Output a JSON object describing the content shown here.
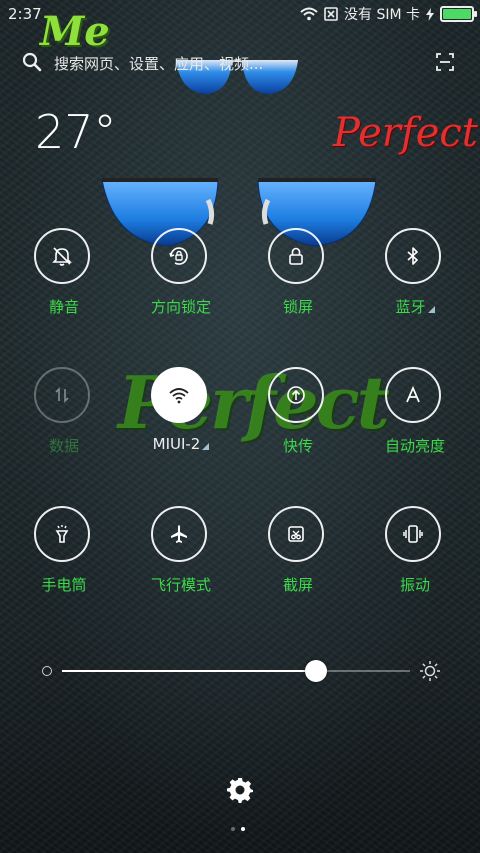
{
  "status_bar": {
    "time": "2:37",
    "carrier": "没有 SIM 卡",
    "battery_level": 1.0,
    "battery_color": "#4cd964"
  },
  "decorations": {
    "me_text": "Me",
    "perfect_red_text": "Perfect",
    "perfect_green_text": "Perfect"
  },
  "search": {
    "placeholder": "搜索网页、设置、应用、视频...",
    "icon": "search-icon",
    "scan_icon": "scan-icon"
  },
  "weather": {
    "temperature": "27°"
  },
  "tiles": [
    {
      "label": "静音",
      "icon": "bell-off-icon",
      "state": "on"
    },
    {
      "label": "方向锁定",
      "icon": "rotation-lock-icon",
      "state": "on"
    },
    {
      "label": "锁屏",
      "icon": "lock-icon",
      "state": "on"
    },
    {
      "label": "蓝牙",
      "icon": "bluetooth-icon",
      "state": "on",
      "has_submenu": true
    },
    {
      "label": "数据",
      "icon": "data-icon",
      "state": "disabled"
    },
    {
      "label": "MIUI-2",
      "icon": "wifi-icon",
      "state": "active",
      "has_submenu": true
    },
    {
      "label": "快传",
      "icon": "quick-transfer-icon",
      "state": "on"
    },
    {
      "label": "自动亮度",
      "icon": "auto-brightness-icon",
      "state": "on"
    },
    {
      "label": "手电筒",
      "icon": "flashlight-icon",
      "state": "on"
    },
    {
      "label": "飞行模式",
      "icon": "airplane-icon",
      "state": "on"
    },
    {
      "label": "截屏",
      "icon": "screenshot-icon",
      "state": "on"
    },
    {
      "label": "振动",
      "icon": "vibrate-icon",
      "state": "on"
    }
  ],
  "brightness": {
    "level": 0.73
  },
  "colors": {
    "label_green": "#3dd94a",
    "accent_blue": "#1d7de0"
  },
  "pager": {
    "pages": 2,
    "current": 2
  }
}
